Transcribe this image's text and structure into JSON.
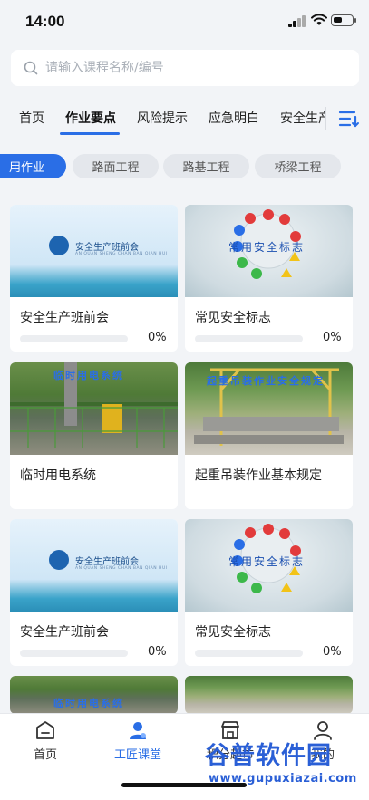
{
  "status_bar": {
    "time": "14:00"
  },
  "search": {
    "placeholder": "请输入课程名称/编号"
  },
  "tabs": [
    {
      "label": "首页"
    },
    {
      "label": "作业要点"
    },
    {
      "label": "风险提示"
    },
    {
      "label": "应急明白"
    },
    {
      "label": "安全生产"
    }
  ],
  "active_tab": "作业要点",
  "chips": [
    {
      "label": "用作业"
    },
    {
      "label": "路面工程"
    },
    {
      "label": "路基工程"
    },
    {
      "label": "桥梁工程"
    }
  ],
  "active_chip": "用作业",
  "courses": [
    {
      "title": "安全生产班前会",
      "progress": 0,
      "progress_label": "0%",
      "image": "meeting-banner",
      "image_text": "安全生产班前会",
      "image_sub": "AN QUAN SHENG CHAN BAN QIAN HUI"
    },
    {
      "title": "常见安全标志",
      "progress": 0,
      "progress_label": "0%",
      "image": "safety-signs",
      "image_text": "常用安全标志"
    },
    {
      "title": "临时用电系统",
      "progress": null,
      "progress_label": "",
      "image": "power-site",
      "image_text": "临时用电系统"
    },
    {
      "title": "起重吊装作业基本规定",
      "progress": null,
      "progress_label": "",
      "image": "crane-site",
      "image_text": "起重吊装作业安全规定"
    },
    {
      "title": "安全生产班前会",
      "progress": 0,
      "progress_label": "0%",
      "image": "meeting-banner",
      "image_text": "安全生产班前会",
      "image_sub": "AN QUAN SHENG CHAN BAN QIAN HUI"
    },
    {
      "title": "常见安全标志",
      "progress": 0,
      "progress_label": "0%",
      "image": "safety-signs",
      "image_text": "常用安全标志"
    },
    {
      "title": "",
      "progress": null,
      "progress_label": "",
      "image": "power-site",
      "image_text": "临时用电系统"
    },
    {
      "title": "",
      "progress": null,
      "progress_label": "",
      "image": "crane-site",
      "image_text": ""
    }
  ],
  "bottom_nav": [
    {
      "label": "首页",
      "icon": "home-icon"
    },
    {
      "label": "工匠课堂",
      "icon": "person-icon"
    },
    {
      "label": "积分超市",
      "icon": "store-icon"
    },
    {
      "label": "我的",
      "icon": "user-icon"
    }
  ],
  "active_nav": "工匠课堂",
  "watermark": {
    "main": "谷普软件园",
    "url": "www.gupuxiazai.com"
  },
  "colors": {
    "accent": "#2a6ee6",
    "background": "#f2f4f7"
  }
}
